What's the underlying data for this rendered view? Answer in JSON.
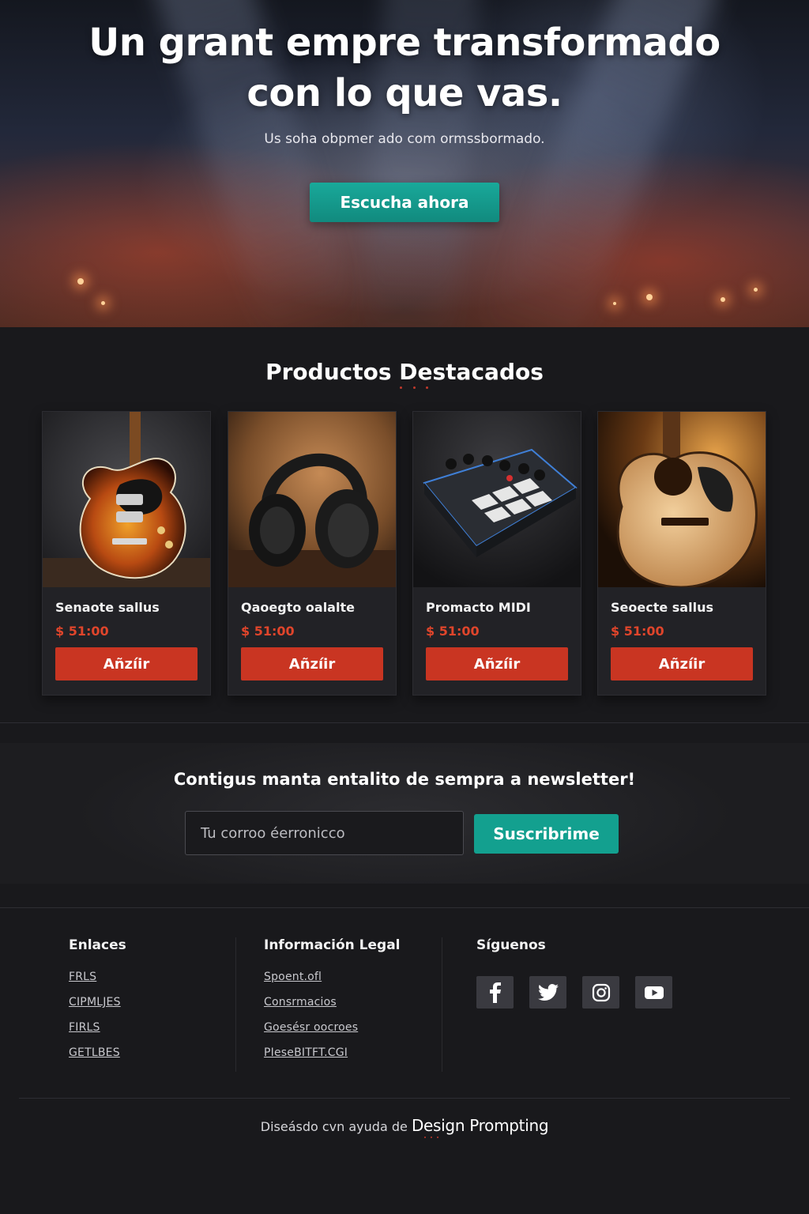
{
  "hero": {
    "title_line1": "Un grant empre transformado",
    "title_line2": "con lo que vas.",
    "subtitle": "Us soha obpmer ado com ormssbormado.",
    "cta_label": "Escucha ahora"
  },
  "products": {
    "title": "Productos Destacados",
    "items": [
      {
        "name": "Senaote sallus",
        "price": "$ 51:00",
        "button": "Añzíir",
        "image": "electric-guitar"
      },
      {
        "name": "Qaoegto oalalte",
        "price": "$ 51:00",
        "button": "Añzíir",
        "image": "headphones"
      },
      {
        "name": "Promacto MIDI",
        "price": "$ 51:00",
        "button": "Añzíir",
        "image": "midi-controller"
      },
      {
        "name": "Seoecte sallus",
        "price": "$ 51:00",
        "button": "Añzíir",
        "image": "acoustic-guitar"
      }
    ]
  },
  "newsletter": {
    "title": "Contigus manta entalito de sempra a newsletter!",
    "placeholder": "Tu corroo éerronicco",
    "button": "Suscribrime"
  },
  "footer": {
    "links_title": "Enlaces",
    "links": [
      "FRLS",
      "CIPMLJES",
      "FIRLS",
      "GETLBES"
    ],
    "legal_title": "Información Legal",
    "legal": [
      "Spoent.ofl",
      "Consrmacios",
      "Goesésr oocroes",
      "PIeseBITFT.CGI"
    ],
    "social_title": "Síguenos",
    "social_icons": [
      "facebook-icon",
      "twitter-icon",
      "instagram-icon",
      "youtube-icon"
    ]
  },
  "credit": {
    "prefix": "Diseásdo cvn ayuda de",
    "brand": "Design Prompting"
  },
  "colors": {
    "accent_teal": "#13a08f",
    "accent_red": "#c93522",
    "price_red": "#e0452b",
    "background": "#19191c"
  }
}
